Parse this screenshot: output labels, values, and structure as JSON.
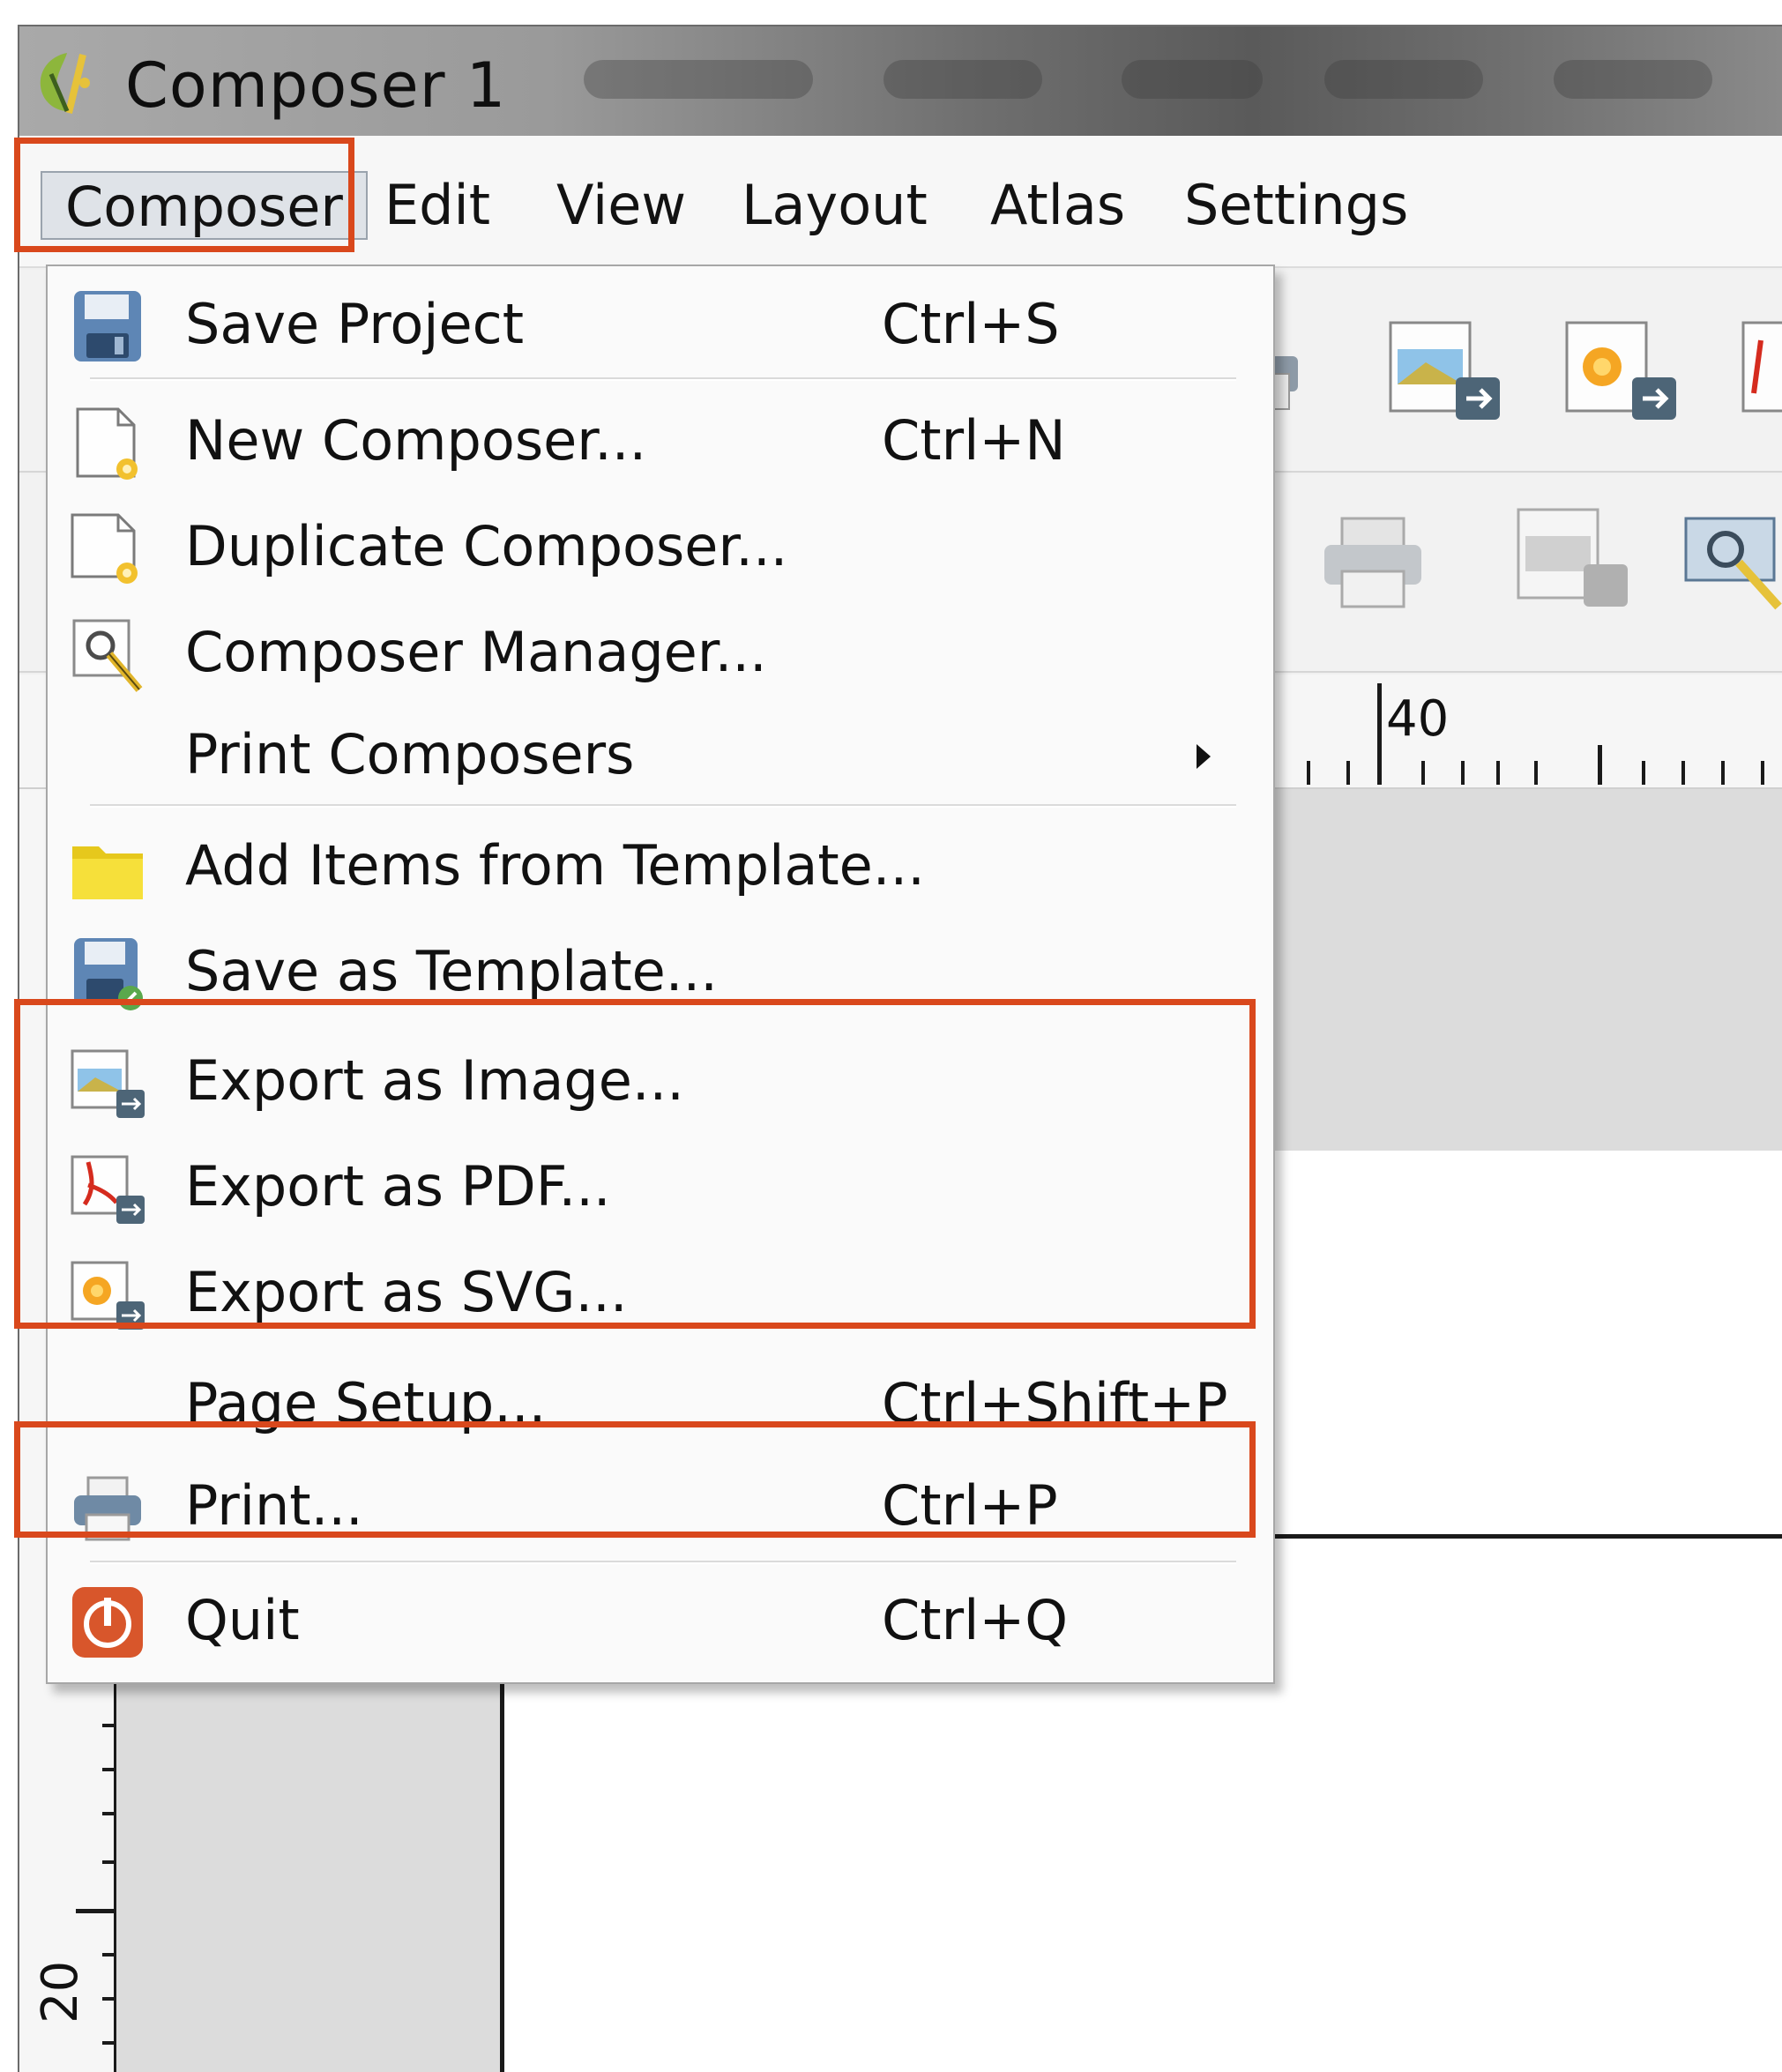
{
  "window": {
    "title": "Composer 1"
  },
  "menubar": {
    "items": [
      {
        "label": "Composer"
      },
      {
        "label": "Edit"
      },
      {
        "label": "View"
      },
      {
        "label": "Layout"
      },
      {
        "label": "Atlas"
      },
      {
        "label": "Settings"
      }
    ]
  },
  "ruler": {
    "top_label": "40",
    "left_label": "20"
  },
  "composer_menu": {
    "items": [
      {
        "label": "Save Project",
        "shortcut": "Ctrl+S",
        "icon": "save-icon"
      },
      {
        "label": "New Composer...",
        "shortcut": "Ctrl+N",
        "icon": "new-composer-icon"
      },
      {
        "label": "Duplicate Composer...",
        "shortcut": "",
        "icon": "duplicate-composer-icon"
      },
      {
        "label": "Composer Manager...",
        "shortcut": "",
        "icon": "composer-manager-icon"
      },
      {
        "label": "Print Composers",
        "shortcut": "",
        "icon": ""
      },
      {
        "label": "Add Items from Template...",
        "shortcut": "",
        "icon": "folder-icon"
      },
      {
        "label": "Save as Template...",
        "shortcut": "",
        "icon": "save-template-icon"
      },
      {
        "label": "Export as Image...",
        "shortcut": "",
        "icon": "export-image-icon"
      },
      {
        "label": "Export as PDF...",
        "shortcut": "",
        "icon": "export-pdf-icon"
      },
      {
        "label": "Export as SVG...",
        "shortcut": "",
        "icon": "export-svg-icon"
      },
      {
        "label": "Page Setup...",
        "shortcut": "Ctrl+Shift+P",
        "icon": ""
      },
      {
        "label": "Print...",
        "shortcut": "Ctrl+P",
        "icon": "print-icon"
      },
      {
        "label": "Quit",
        "shortcut": "Ctrl+Q",
        "icon": "quit-icon"
      }
    ]
  },
  "colors": {
    "highlight": "#d9481c",
    "menu_background": "#fafafa",
    "active_menu": "#dfe3e8"
  }
}
